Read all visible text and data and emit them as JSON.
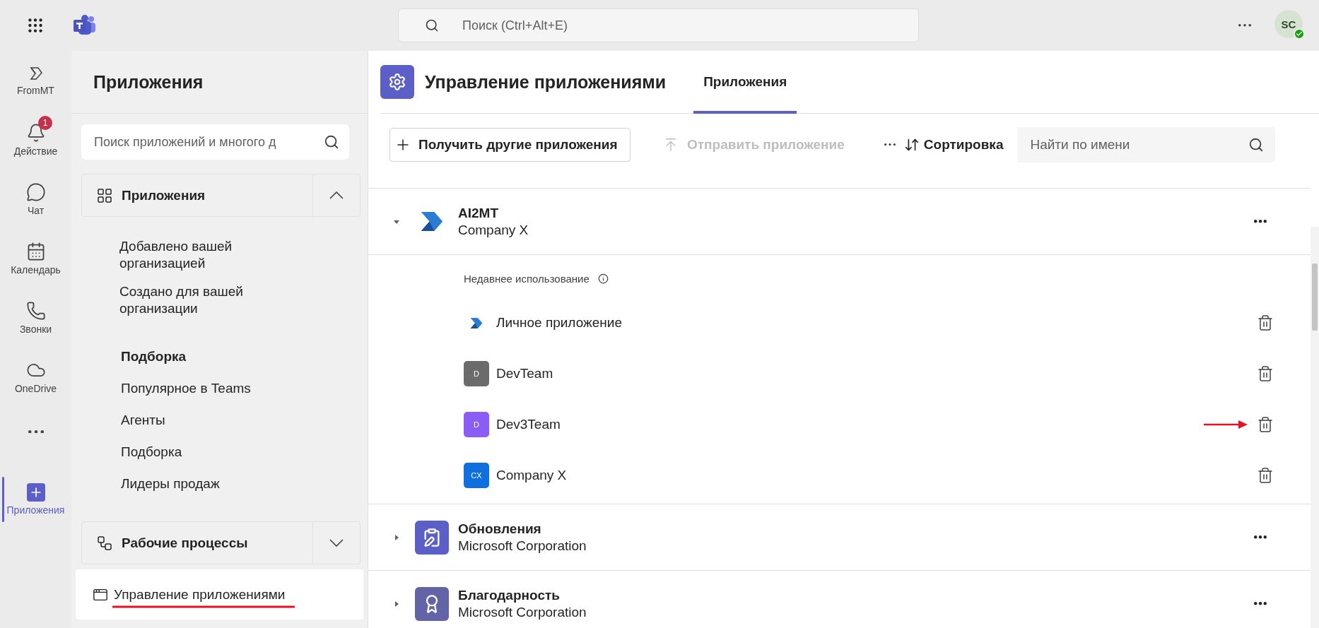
{
  "top_bar": {
    "search": {
      "placeholder": "Поиск (Ctrl+Alt+E)"
    },
    "avatar": {
      "initials": "SC",
      "online": true
    }
  },
  "rail": [
    {
      "label": "FromMT",
      "kind": "app",
      "selected": false
    },
    {
      "label": "Действие",
      "kind": "bell",
      "selected": false,
      "badge": "1"
    },
    {
      "label": "Чат",
      "kind": "chat",
      "selected": false
    },
    {
      "label": "Календарь",
      "kind": "calendar",
      "selected": false
    },
    {
      "label": "Звонки",
      "kind": "phone",
      "selected": false
    },
    {
      "label": "OneDrive",
      "kind": "cloud",
      "selected": false
    },
    {
      "kind": "more",
      "selected": false
    },
    {
      "label": "Приложения",
      "kind": "apps",
      "selected": true
    }
  ],
  "sidebar": {
    "title": "Приложения",
    "search": {
      "placeholder": "Поиск приложений и многого д"
    },
    "sections": [
      {
        "title": "Приложения",
        "kind": "apps",
        "expanded": true,
        "items": [
          {
            "label": "Добавлено вашей организацией",
            "kind": "link"
          },
          {
            "label": "Создано для вашей организации",
            "kind": "link"
          },
          {
            "label": "Подборка",
            "kind": "heading"
          },
          {
            "label": "Популярное в Teams",
            "kind": "link"
          },
          {
            "label": "Агенты",
            "kind": "link"
          },
          {
            "label": "Подборка",
            "kind": "link"
          },
          {
            "label": "Лидеры продаж",
            "kind": "link"
          }
        ]
      },
      {
        "title": "Рабочие процессы",
        "kind": "workflows",
        "expanded": false
      }
    ],
    "footer": {
      "label": "Управление приложениями",
      "selected": true
    }
  },
  "main": {
    "title": "Управление приложениями",
    "tabs": [
      {
        "label": "Приложения",
        "selected": true
      }
    ],
    "toolbar": {
      "get_button": "Получить другие приложения",
      "send_button": {
        "label": "Отправить приложение",
        "disabled": true
      },
      "sort_button": "Сортировка",
      "search": {
        "placeholder": "Найти по имени"
      }
    },
    "apps": [
      {
        "name": "AI2MT",
        "publisher": "Company X",
        "kind": "logo",
        "expanded": true,
        "recent_label": "Недавнее использование",
        "recent": [
          {
            "name": "Личное приложение",
            "kind": "logo"
          },
          {
            "name": "DevTeam",
            "kind": "letter",
            "letter": "D",
            "color": "#6b6b6b"
          },
          {
            "name": "Dev3Team",
            "kind": "letter",
            "letter": "D",
            "color": "#8b5cf6",
            "highlighted": true
          },
          {
            "name": "Company X",
            "kind": "letter",
            "letter": "CX",
            "color": "#0f6fde"
          }
        ]
      },
      {
        "name": "Обновления",
        "publisher": "Microsoft Corporation",
        "kind": "clipboard",
        "expanded": false
      },
      {
        "name": "Благодарность",
        "publisher": "Microsoft Corporation",
        "kind": "award",
        "expanded": false
      }
    ]
  }
}
